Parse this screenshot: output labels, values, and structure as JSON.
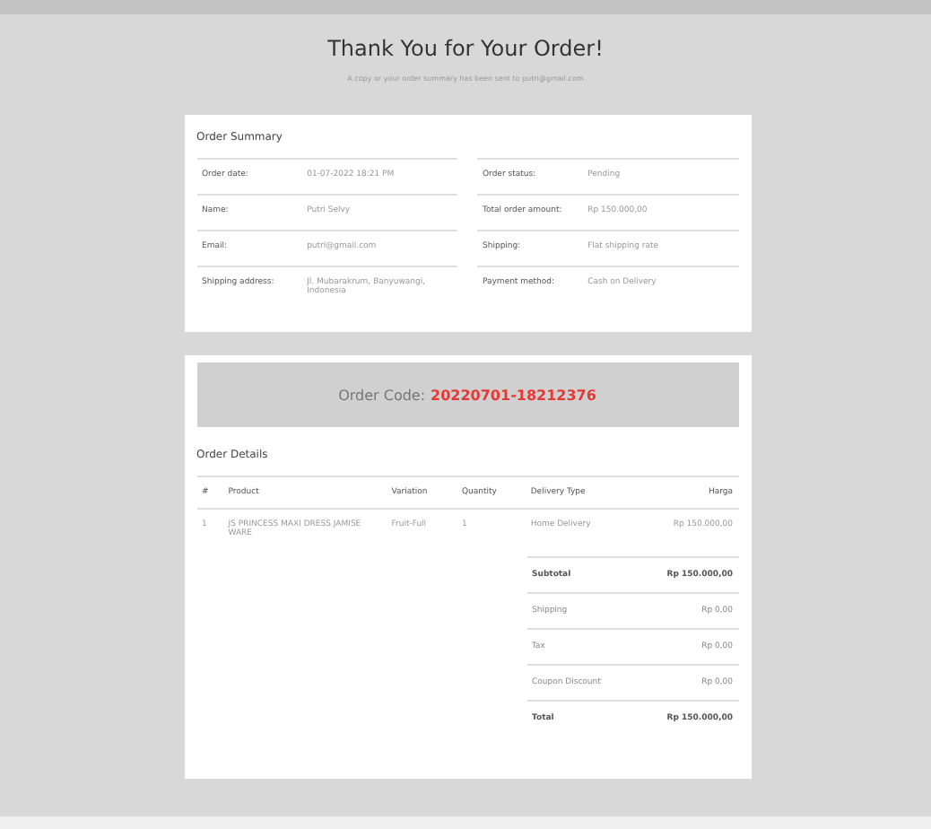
{
  "header": {
    "title": "Thank You for Your Order!",
    "subtitle": "A copy or your order summary has been sent to putri@gmail.com"
  },
  "summary": {
    "title": "Order Summary",
    "left": [
      {
        "label": "Order date:",
        "value": "01-07-2022 18:21 PM"
      },
      {
        "label": "Name:",
        "value": "Putri Selvy"
      },
      {
        "label": "Email:",
        "value": "putri@gmail.com"
      },
      {
        "label": "Shipping address:",
        "value": "Jl. Mubarakrum, Banyuwangi, Indonesia"
      }
    ],
    "right": [
      {
        "label": "Order status:",
        "value": "Pending"
      },
      {
        "label": "Total order amount:",
        "value": "Rp 150.000,00"
      },
      {
        "label": "Shipping:",
        "value": "Flat shipping rate"
      },
      {
        "label": "Payment method:",
        "value": "Cash on Delivery"
      }
    ]
  },
  "order_code": {
    "label": "Order Code:",
    "code": "20220701-18212376"
  },
  "details": {
    "title": "Order Details",
    "columns": [
      "#",
      "Product",
      "Variation",
      "Quantity",
      "Delivery Type",
      "Harga"
    ],
    "rows": [
      [
        "1",
        "JS PRINCESS MAXI DRESS JAMISE WARE",
        "Fruit-Full",
        "1",
        "Home Delivery",
        "Rp 150.000,00"
      ]
    ],
    "totals": [
      {
        "label": "Subtotal",
        "value": "Rp 150.000,00",
        "bold": true
      },
      {
        "label": "Shipping",
        "value": "Rp 0,00",
        "bold": false
      },
      {
        "label": "Tax",
        "value": "Rp 0,00",
        "bold": false
      },
      {
        "label": "Coupon Discount",
        "value": "Rp 0,00",
        "bold": false
      },
      {
        "label": "Total",
        "value": "Rp 150.000,00",
        "bold": true
      }
    ]
  }
}
